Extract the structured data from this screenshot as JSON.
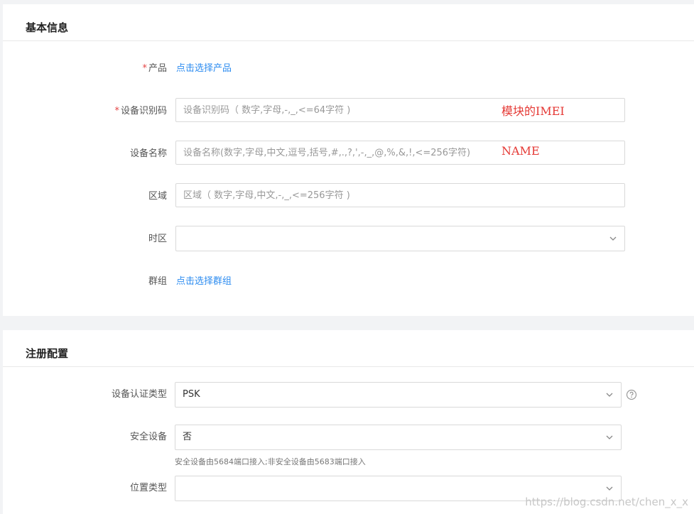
{
  "basic": {
    "title": "基本信息",
    "product": {
      "label": "产品",
      "link": "点击选择产品"
    },
    "imei": {
      "label": "设备识别码",
      "placeholder": "设备识别码（ 数字,字母,-,_,<=64字符 )",
      "annotation": "模块的IMEI"
    },
    "name": {
      "label": "设备名称",
      "placeholder": "设备名称(数字,字母,中文,逗号,括号,#,.,?,',-,_,@,%,&,!,<=256字符)",
      "annotation": "NAME"
    },
    "region": {
      "label": "区域",
      "placeholder": "区域（ 数字,字母,中文,-,_,<=256字符 )"
    },
    "timezone": {
      "label": "时区",
      "value": ""
    },
    "group": {
      "label": "群组",
      "link": "点击选择群组"
    },
    "required_mark": "*"
  },
  "register": {
    "title": "注册配置",
    "auth_type": {
      "label": "设备认证类型",
      "value": "PSK"
    },
    "secure": {
      "label": "安全设备",
      "value": "否",
      "helper": "安全设备由5684端口接入;非安全设备由5683端口接入"
    },
    "location": {
      "label": "位置类型",
      "value": ""
    }
  },
  "watermark": "https://blog.csdn.net/chen_x_x",
  "icons": {
    "chevron": "chevron-down-icon",
    "help": "question-circle-icon"
  }
}
